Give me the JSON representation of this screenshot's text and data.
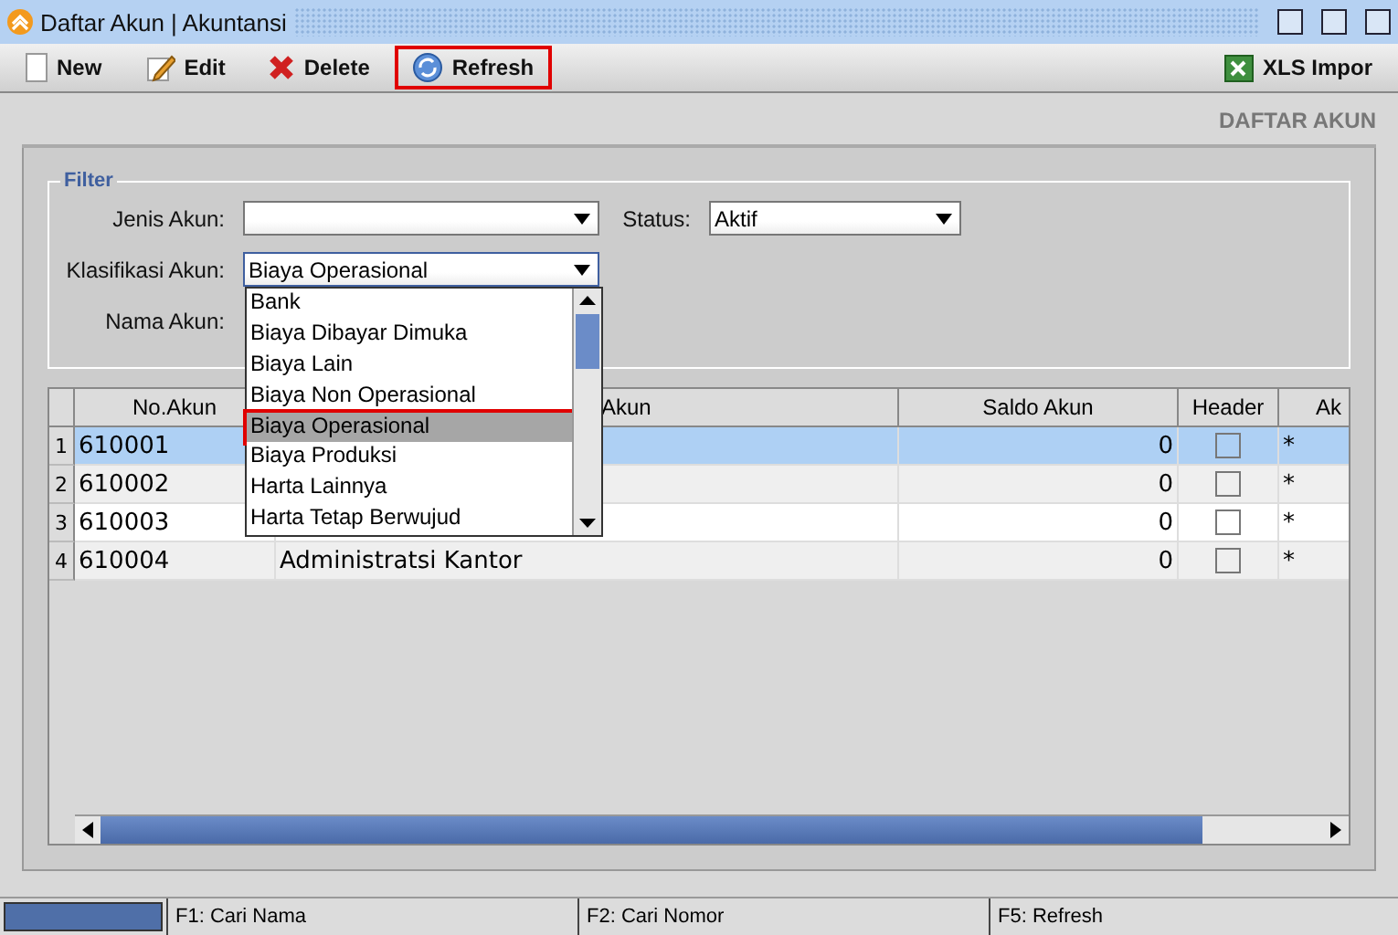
{
  "window": {
    "title": "Daftar Akun | Akuntansi"
  },
  "toolbar": [
    {
      "label": "New",
      "kind": "new",
      "selected": false
    },
    {
      "label": "Edit",
      "kind": "edit",
      "selected": false
    },
    {
      "label": "Delete",
      "kind": "delete",
      "selected": false
    },
    {
      "label": "Refresh",
      "kind": "refresh",
      "selected": true
    }
  ],
  "import_button": {
    "label": "XLS Impor"
  },
  "page_title": "DAFTAR AKUN",
  "filter": {
    "legend": "Filter",
    "jenis_akun": {
      "label": "Jenis Akun:"
    },
    "status": {
      "label": "Status:",
      "value": "Aktif"
    },
    "klasifikasi_akun": {
      "label": "Klasifikasi Akun:",
      "value": "Biaya Operasional",
      "expanded": true,
      "options": [
        {
          "label": "Bank",
          "selected": false
        },
        {
          "label": "Biaya Dibayar Dimuka",
          "selected": false
        },
        {
          "label": "Biaya Lain",
          "selected": false
        },
        {
          "label": "Biaya Non Operasional",
          "selected": false
        },
        {
          "label": "Biaya Operasional",
          "selected": true
        },
        {
          "label": "Biaya Produksi",
          "selected": false
        },
        {
          "label": "Harta Lainnya",
          "selected": false
        },
        {
          "label": "Harta Tetap Berwujud",
          "selected": false
        }
      ]
    },
    "nama_akun": {
      "label": "Nama Akun:"
    }
  },
  "table": {
    "columns": [
      "No.Akun",
      "Akun",
      "Saldo Akun",
      "Header",
      "Ak"
    ],
    "rows": [
      {
        "index": "1",
        "no": "610001",
        "saldo": "0",
        "header": false,
        "column_5": "*",
        "selected": true
      },
      {
        "index": "2",
        "no": "610002",
        "saldo": "0",
        "header": false,
        "column_5": "*",
        "selected": false
      },
      {
        "index": "3",
        "no": "610003",
        "saldo": "0",
        "header": false,
        "column_5": "*",
        "selected": false
      },
      {
        "index": "4",
        "no": "610004",
        "name": "Administratsi Kantor",
        "saldo": "0",
        "header": false,
        "column_5": "*",
        "selected": false
      }
    ]
  },
  "status_bar": [
    "F1: Cari Nama",
    "F2: Cari Nomor",
    "F5: Refresh"
  ]
}
